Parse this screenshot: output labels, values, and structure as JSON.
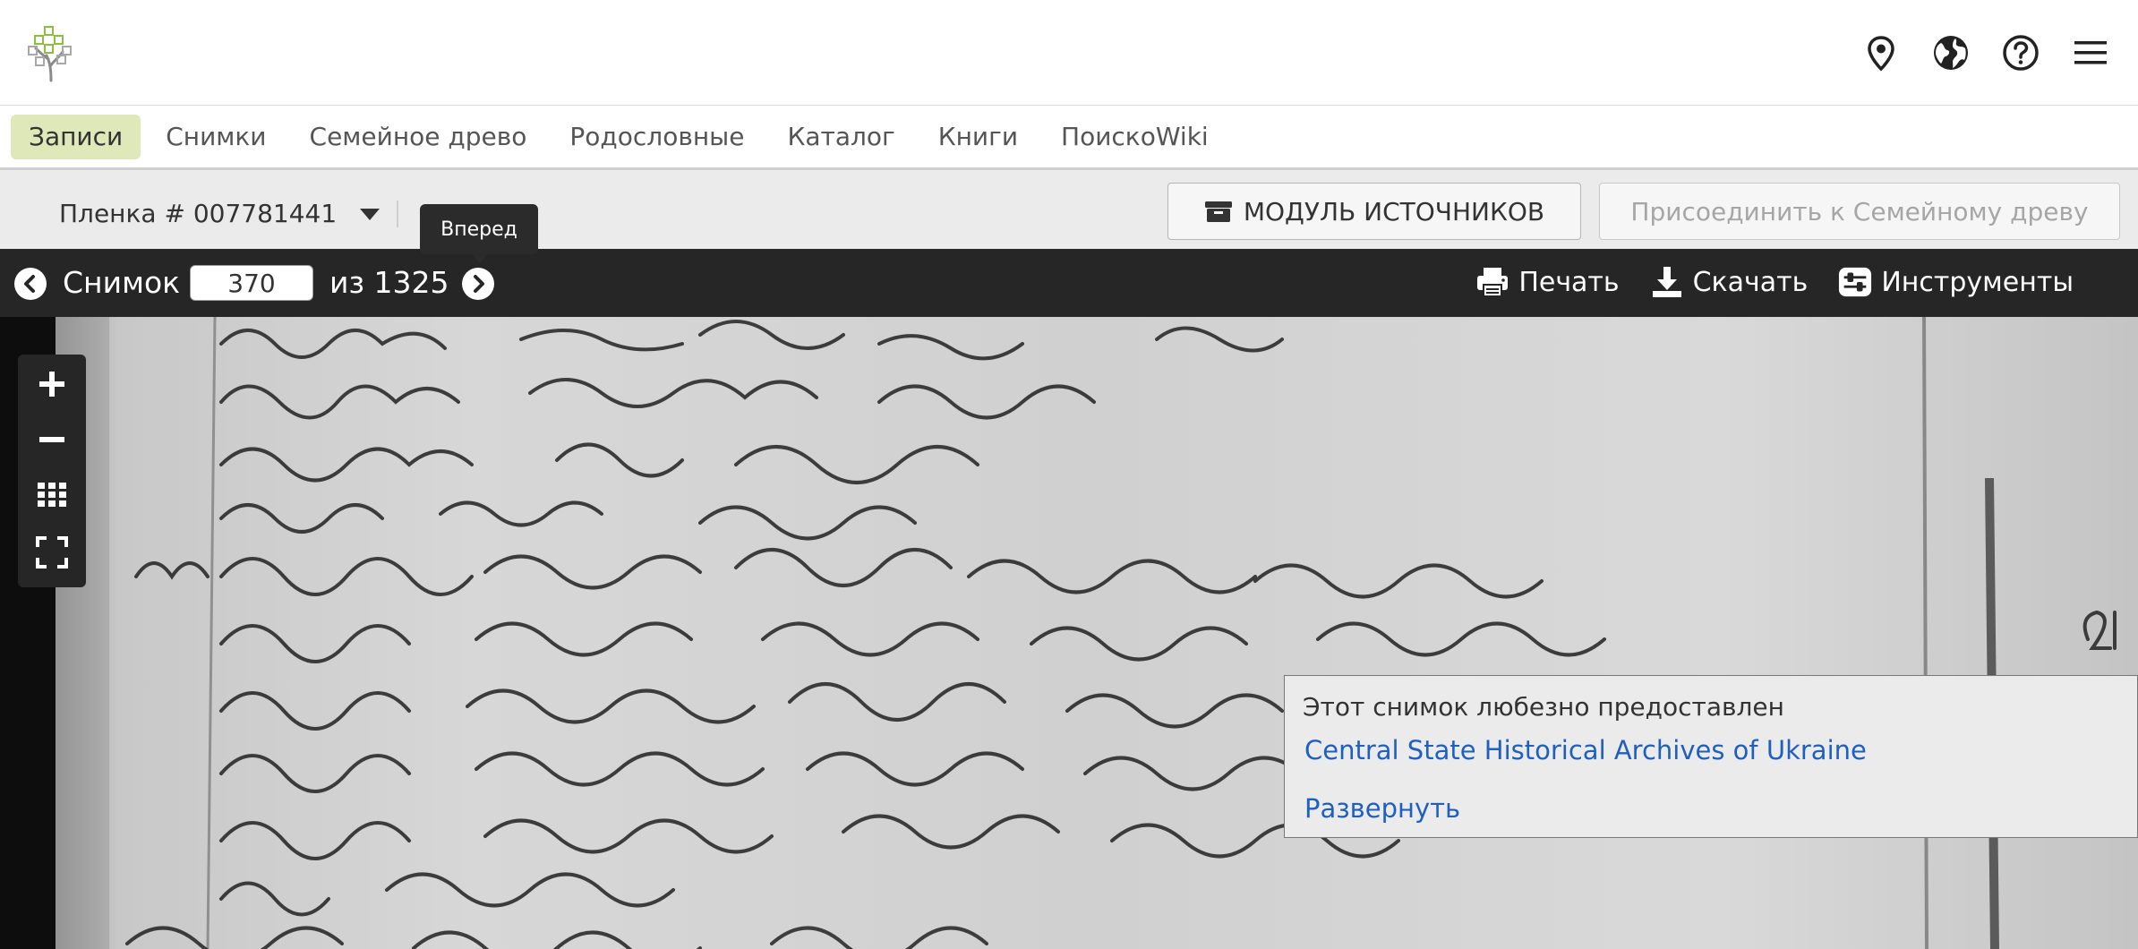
{
  "header": {
    "logo_icon": "tree-logo-icon",
    "icons": [
      "location-pin-icon",
      "globe-icon",
      "help-icon",
      "menu-icon"
    ]
  },
  "nav": {
    "items": [
      {
        "label": "Записи",
        "active": true
      },
      {
        "label": "Снимки",
        "active": false
      },
      {
        "label": "Семейное древо",
        "active": false
      },
      {
        "label": "Родословные",
        "active": false
      },
      {
        "label": "Каталог",
        "active": false
      },
      {
        "label": "Книги",
        "active": false
      },
      {
        "label": "ПоискоWiki",
        "active": false
      }
    ],
    "active_color": "#dfe8b8"
  },
  "film": {
    "label": "Пленка # 007781441",
    "source_button": "МОДУЛЬ ИСТОЧНИКОВ",
    "attach_button": "Присоединить к Семейному древу"
  },
  "toolbar": {
    "image_label": "Снимок",
    "image_number": "370",
    "of_label": "из 1325",
    "print": "Печать",
    "download": "Скачать",
    "tools": "Инструменты"
  },
  "tooltip": {
    "text": "Вперед"
  },
  "viewer": {
    "zoom_icons": [
      "zoom-in-icon",
      "zoom-out-icon",
      "grid-view-icon",
      "fullscreen-icon"
    ],
    "source_panel": {
      "text": "Этот снимок любезно предоставлен",
      "link": "Central State Historical Archives of Ukraine",
      "expand": "Развернуть"
    }
  },
  "colors": {
    "toolbar": "#262626",
    "link": "#1f5fbf",
    "film_bar": "#ebebeb"
  }
}
